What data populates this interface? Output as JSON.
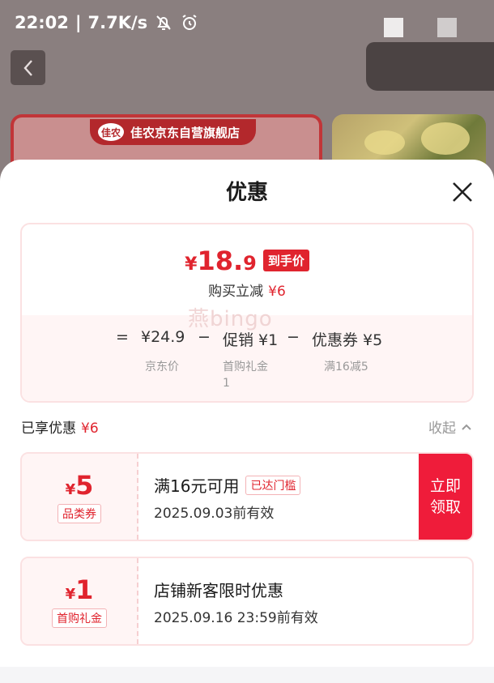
{
  "status_bar": {
    "time": "22:02",
    "speed": "7.7K/s"
  },
  "background": {
    "store_name": "佳农京东自营旗舰店",
    "store_logo_text": "佳农"
  },
  "sheet": {
    "title": "优惠"
  },
  "summary": {
    "final_price_symbol": "¥",
    "final_price_int": "18.",
    "final_price_dec": "9",
    "final_price_tag": "到手价",
    "reduce_label": "购买立减",
    "reduce_amount": "¥6",
    "watermark": "燕bingo",
    "formula": {
      "equals": "=",
      "jd_price": "¥24.9",
      "minus1": "−",
      "promo": "促销 ¥1",
      "minus2": "−",
      "coupon": "优惠券 ¥5",
      "jd_price_label": "京东价",
      "promo_label": "首购礼金",
      "promo_count": "1",
      "coupon_label": "满16减5"
    }
  },
  "enjoyed": {
    "label": "已享优惠",
    "amount": "¥6",
    "collapse": "收起"
  },
  "coupons": [
    {
      "symbol": "¥",
      "amount": "5",
      "type": "品类券",
      "title": "满16元可用",
      "badge": "已达门槛",
      "valid": "2025.09.03前有效",
      "claim_line1": "立即",
      "claim_line2": "领取"
    },
    {
      "symbol": "¥",
      "amount": "1",
      "type": "首购礼金",
      "title": "店铺新客限时优惠",
      "valid": "2025.09.16 23:59前有效"
    }
  ],
  "colors": {
    "accent": "#e0242e",
    "claim_button": "#ef1c3a",
    "light_pink": "#fff5f5"
  }
}
